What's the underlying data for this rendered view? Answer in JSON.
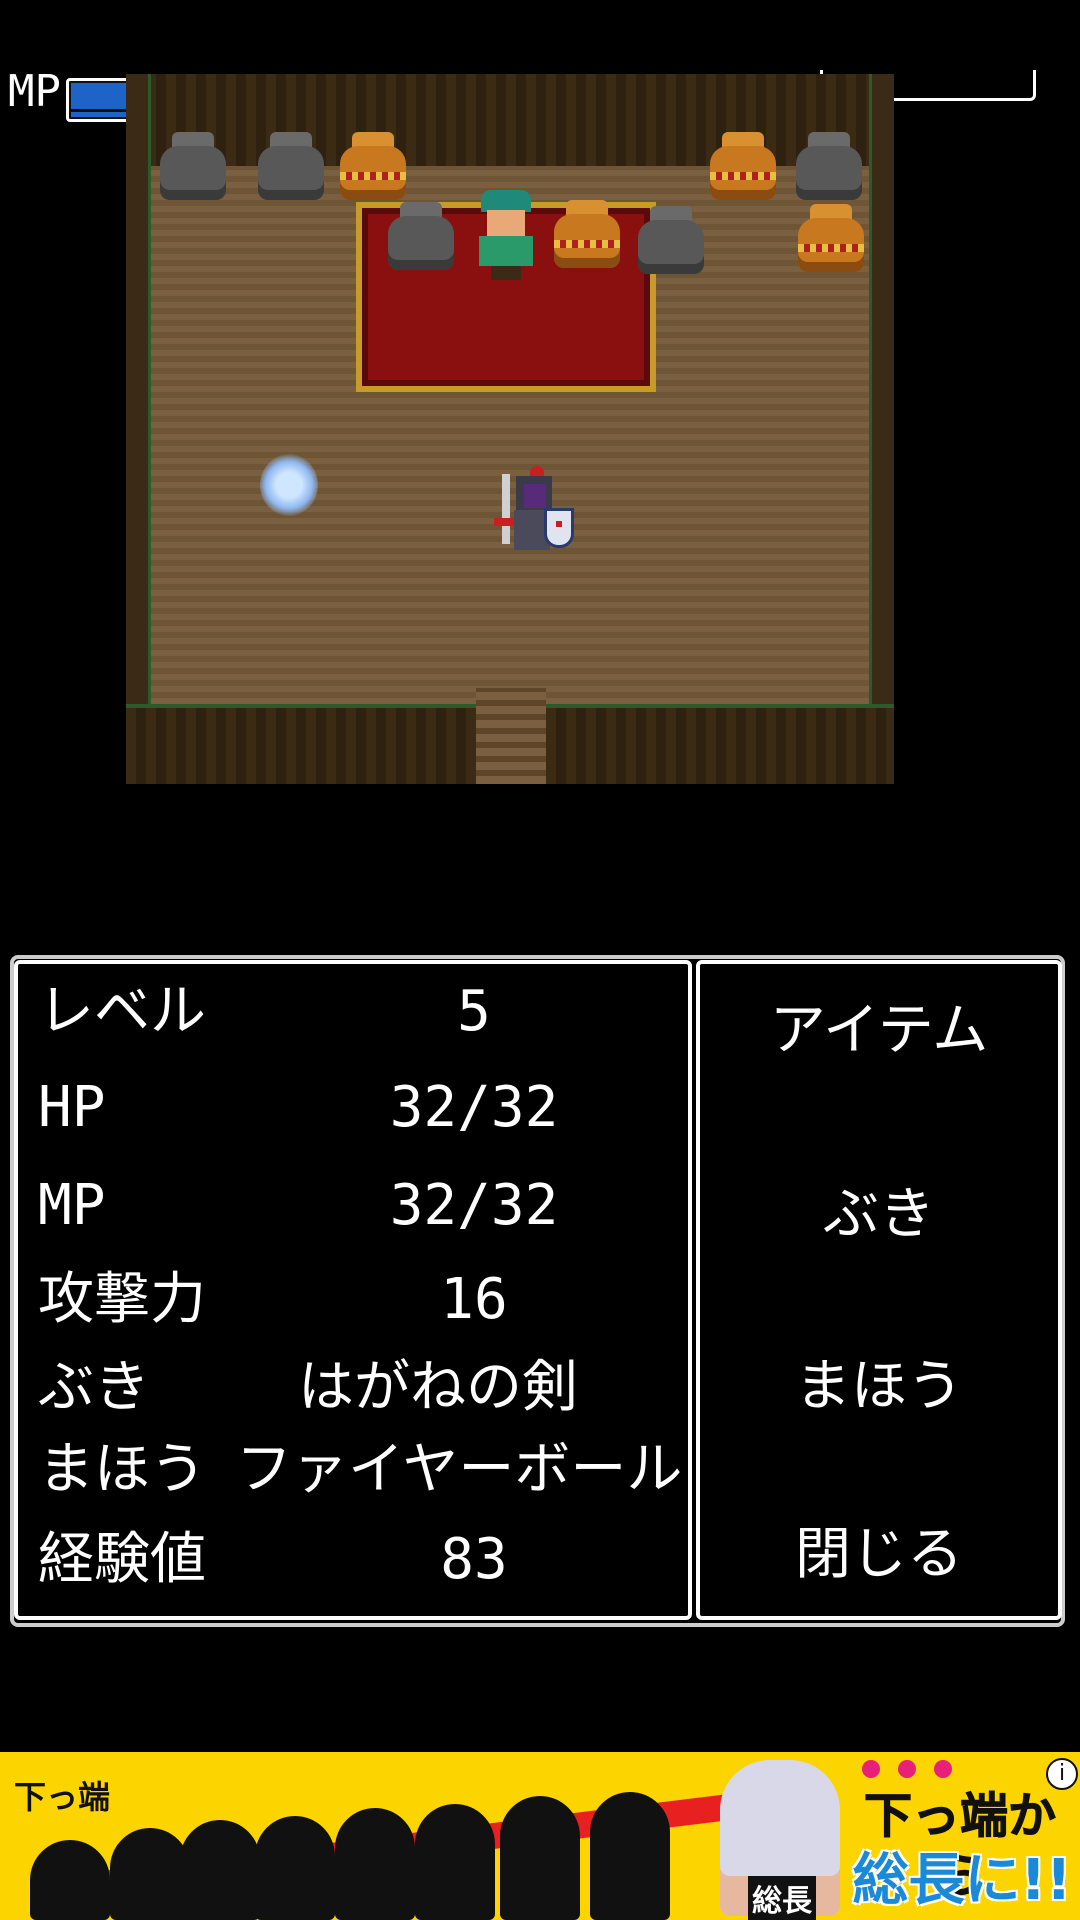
{
  "hud": {
    "mp_label": "MP",
    "mp_level": 1.0
  },
  "status": {
    "rows": [
      {
        "label": "レベル",
        "value": "5"
      },
      {
        "label": "HP",
        "value": "32/32"
      },
      {
        "label": "MP",
        "value": "32/32"
      },
      {
        "label": "攻撃力",
        "value": "16"
      },
      {
        "label": "ぶき",
        "value": "はがねの剣"
      },
      {
        "label": "まほう",
        "value": "ファイヤーボール"
      },
      {
        "label": "経験値",
        "value": "83"
      }
    ]
  },
  "menu": {
    "items": [
      "アイテム",
      "ぶき",
      "まほう",
      "閉じる"
    ]
  },
  "ad": {
    "tag": "下っ端",
    "character_label": "総長",
    "headline_line1": "下っ端から",
    "headline_line2": "総長に!!",
    "info_symbol": "i"
  }
}
